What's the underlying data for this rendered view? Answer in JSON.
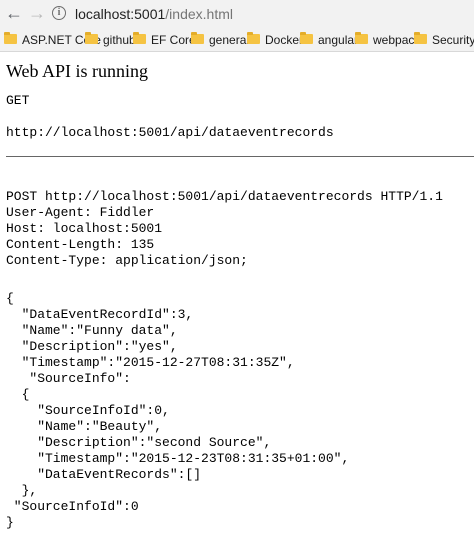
{
  "browser": {
    "url_host": "localhost:5001",
    "url_path": "/index.html",
    "back_icon": "arrow-left",
    "forward_icon": "arrow-right",
    "info_icon": "i"
  },
  "bookmarks": [
    {
      "label": "ASP.NET Core"
    },
    {
      "label": "github"
    },
    {
      "label": "EF Core"
    },
    {
      "label": "general"
    },
    {
      "label": "Docker"
    },
    {
      "label": "angular"
    },
    {
      "label": "webpack"
    },
    {
      "label": "Security"
    }
  ],
  "page": {
    "title": "Web API is running",
    "method": "GET",
    "get_url": "http://localhost:5001/api/dataeventrecords",
    "request_headers": "POST http://localhost:5001/api/dataeventrecords HTTP/1.1\nUser-Agent: Fiddler\nHost: localhost:5001\nContent-Length: 135\nContent-Type: application/json;",
    "request_body": "{\n  \"DataEventRecordId\":3,\n  \"Name\":\"Funny data\",\n  \"Description\":\"yes\",\n  \"Timestamp\":\"2015-12-27T08:31:35Z\",\n   \"SourceInfo\":\n  {\n    \"SourceInfoId\":0,\n    \"Name\":\"Beauty\",\n    \"Description\":\"second Source\",\n    \"Timestamp\":\"2015-12-23T08:31:35+01:00\",\n    \"DataEventRecords\":[]\n  },\n \"SourceInfoId\":0\n}"
  }
}
